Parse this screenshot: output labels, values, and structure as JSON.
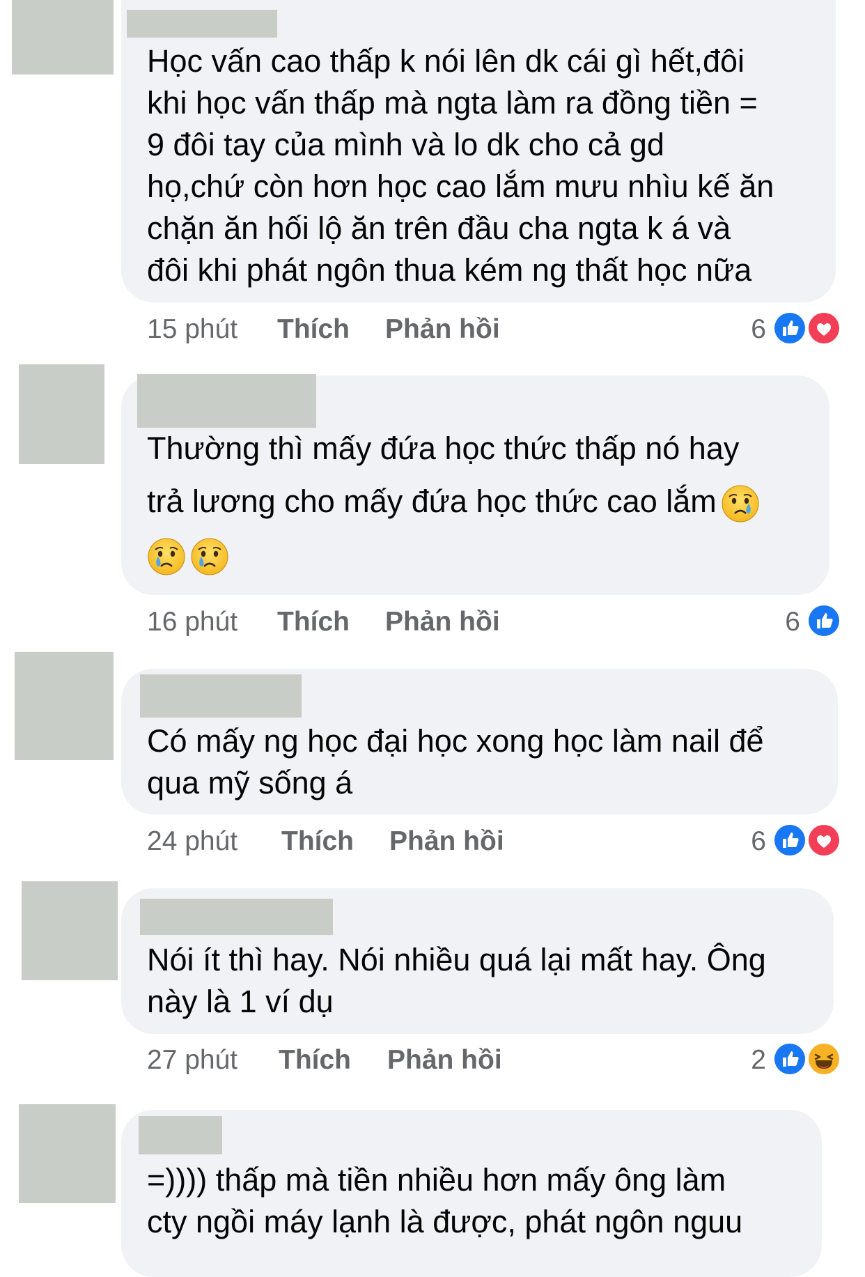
{
  "comments": [
    {
      "text": "Học vấn cao thấp k nói lên dk cái gì hết,đôi\nkhi học vấn thấp mà ngta làm ra đồng tiền =\n9 đôi tay của mình và lo dk cho cả gd\nhọ,chứ còn hơn học cao lắm mưu nhìu kế ăn\nchặn ăn hối lộ ăn trên đầu cha ngta k á và\nđôi khi phát ngôn thua kém ng thất học nữa",
      "time": "15 phút",
      "like_label": "Thích",
      "reply_label": "Phản hồi",
      "reaction_count": "6",
      "reactions": [
        "like-icon",
        "love-icon"
      ]
    },
    {
      "text": "Thường thì mấy đứa học thức thấp nó hay\ntrả lương cho mấy đứa học thức cao lắm",
      "emoji_inline": "crying-face-emoji",
      "emoji_line": [
        "crying-face-emoji",
        "crying-face-emoji"
      ],
      "time": "16 phút",
      "like_label": "Thích",
      "reply_label": "Phản hồi",
      "reaction_count": "6",
      "reactions": [
        "like-icon"
      ]
    },
    {
      "text": "Có mấy ng học đại học xong học làm nail để\nqua mỹ sống á",
      "time": "24 phút",
      "like_label": "Thích",
      "reply_label": "Phản hồi",
      "reaction_count": "6",
      "reactions": [
        "like-icon",
        "love-icon"
      ]
    },
    {
      "text": "Nói ít thì hay. Nói nhiều quá lại mất hay. Ông\nnày là 1 ví dụ",
      "time": "27 phút",
      "like_label": "Thích",
      "reply_label": "Phản hồi",
      "reaction_count": "2",
      "reactions": [
        "like-icon",
        "haha-icon"
      ]
    },
    {
      "text": "=)))) thấp mà tiền nhiều hơn mấy ông làm\ncty ngồi máy lạnh là được, phát ngôn nguu"
    }
  ],
  "colors": {
    "bubble": "#f0f2f5",
    "redaction": "#c8cdc8",
    "meta_text": "#65676b",
    "like_blue": "#1877f2",
    "love_red": "#f33e58",
    "haha_yellow": "#f7b125"
  }
}
